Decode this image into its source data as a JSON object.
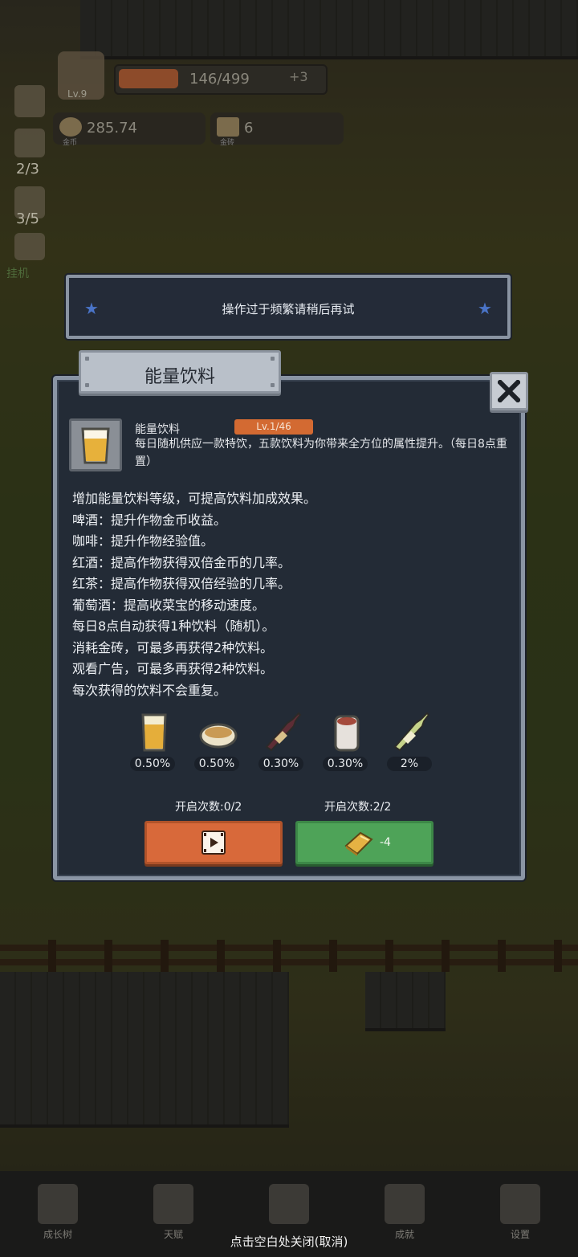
{
  "hud": {
    "level": "Lv.9",
    "xp_text": "146/499",
    "xp_fraction": 0.29,
    "bonus": "+3",
    "coins": "285.74",
    "coins_label": "金币",
    "gold_bricks": "6",
    "gold_bricks_label": "金砖",
    "side_counts": [
      "2/3",
      "3/5"
    ],
    "side_label": "挂机"
  },
  "toast": {
    "message": "操作过于频繁请稍后再试"
  },
  "dialog": {
    "title": "能量饮料",
    "item_name": "能量饮料",
    "level_badge": "Lv.1/46",
    "item_desc": "每日随机供应一款特饮，五款饮料为你带来全方位的属性提升。（每日8点重置）",
    "lines": [
      "增加能量饮料等级，可提高饮料加成效果。",
      "啤酒：提升作物金币收益。",
      "咖啡：提升作物经验值。",
      "红酒：提高作物获得双倍金币的几率。",
      "红茶：提高作物获得双倍经验的几率。",
      "葡萄酒：提高收菜宝的移动速度。",
      "每日8点自动获得1种饮料（随机）。",
      "消耗金砖，可最多再获得2种饮料。",
      "观看广告，可最多再获得2种饮料。",
      "每次获得的饮料不会重复。"
    ],
    "drinks": [
      {
        "icon": "beer-icon",
        "pct": "0.50%"
      },
      {
        "icon": "coffee-icon",
        "pct": "0.50%"
      },
      {
        "icon": "red-wine-icon",
        "pct": "0.30%"
      },
      {
        "icon": "black-tea-icon",
        "pct": "0.30%"
      },
      {
        "icon": "white-wine-icon",
        "pct": "2%"
      }
    ],
    "video_count": "开启次数:0/2",
    "gold_count": "开启次数:2/2",
    "gold_cost": "-4"
  },
  "nav": {
    "items": [
      "成长树",
      "天赋",
      "",
      "成就",
      "设置"
    ],
    "close_hint": "点击空白处关闭(取消)"
  },
  "colors": {
    "panel_bg": "#232b36",
    "panel_border": "#8a95a4",
    "video_button": "#d8693a",
    "gold_button": "#4ea358",
    "level_badge": "#d36a32"
  }
}
